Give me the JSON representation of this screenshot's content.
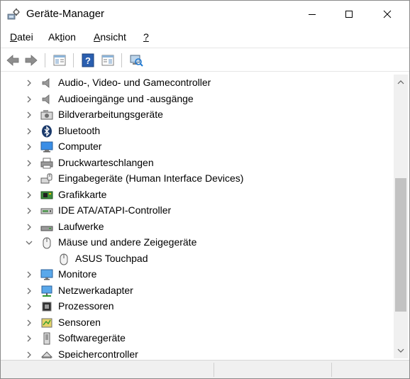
{
  "window": {
    "title": "Geräte-Manager",
    "minimize_icon": "minimize-icon",
    "maximize_icon": "maximize-icon",
    "close_icon": "close-icon"
  },
  "menu": {
    "items": [
      {
        "label_u": "D",
        "label_rest": "atei"
      },
      {
        "label_pre": "Ak",
        "label_u": "t",
        "label_rest": "ion"
      },
      {
        "label_u": "A",
        "label_rest": "nsicht"
      },
      {
        "label_u": "?",
        "label_rest": ""
      }
    ]
  },
  "toolbar": {
    "buttons": [
      "back-icon",
      "forward-icon",
      "properties-icon",
      "help-icon",
      "show-hide-tree-icon",
      "scan-hardware-icon"
    ]
  },
  "tree": {
    "items": [
      {
        "label": "Audio-, Video- und Gamecontroller",
        "icon": "speaker-icon",
        "expanded": false,
        "level": 0
      },
      {
        "label": "Audioeingänge und -ausgänge",
        "icon": "speaker-icon",
        "expanded": false,
        "level": 0
      },
      {
        "label": "Bildverarbeitungsgeräte",
        "icon": "camera-icon",
        "expanded": false,
        "level": 0
      },
      {
        "label": "Bluetooth",
        "icon": "bluetooth-icon",
        "expanded": false,
        "level": 0
      },
      {
        "label": "Computer",
        "icon": "computer-icon",
        "expanded": false,
        "level": 0
      },
      {
        "label": "Druckwarteschlangen",
        "icon": "printer-icon",
        "expanded": false,
        "level": 0
      },
      {
        "label": "Eingabegeräte (Human Interface Devices)",
        "icon": "hid-icon",
        "expanded": false,
        "level": 0
      },
      {
        "label": "Grafikkarte",
        "icon": "graphics-card-icon",
        "expanded": false,
        "level": 0
      },
      {
        "label": "IDE ATA/ATAPI-Controller",
        "icon": "ide-controller-icon",
        "expanded": false,
        "level": 0
      },
      {
        "label": "Laufwerke",
        "icon": "drive-icon",
        "expanded": false,
        "level": 0
      },
      {
        "label": "Mäuse und andere Zeigegeräte",
        "icon": "mouse-icon",
        "expanded": true,
        "level": 0
      },
      {
        "label": "ASUS Touchpad",
        "icon": "mouse-icon",
        "expanded": null,
        "level": 1
      },
      {
        "label": "Monitore",
        "icon": "monitor-icon",
        "expanded": false,
        "level": 0
      },
      {
        "label": "Netzwerkadapter",
        "icon": "network-icon",
        "expanded": false,
        "level": 0
      },
      {
        "label": "Prozessoren",
        "icon": "processor-icon",
        "expanded": false,
        "level": 0
      },
      {
        "label": "Sensoren",
        "icon": "sensor-icon",
        "expanded": false,
        "level": 0
      },
      {
        "label": "Softwaregeräte",
        "icon": "software-device-icon",
        "expanded": false,
        "level": 0
      },
      {
        "label": "Speichercontroller",
        "icon": "storage-controller-icon",
        "expanded": false,
        "level": 0
      }
    ]
  },
  "colors": {
    "accent": "#1e78d2",
    "chevron": "#6d6d6d"
  }
}
